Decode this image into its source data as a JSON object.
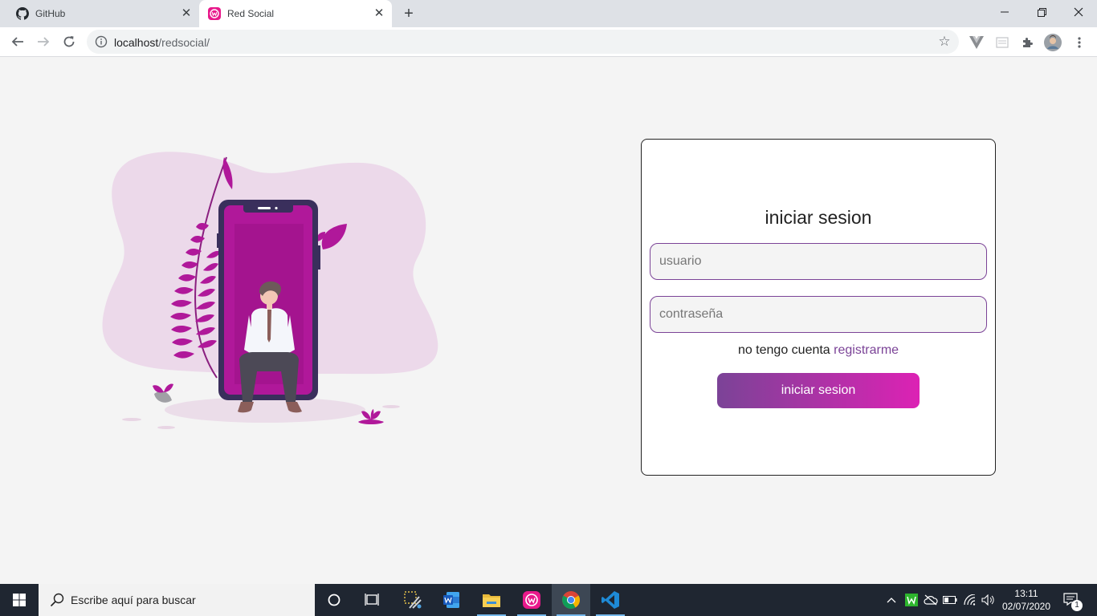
{
  "browser": {
    "tabs": [
      {
        "title": "GitHub",
        "icon": "github-icon"
      },
      {
        "title": "Red Social",
        "icon": "wamp-icon",
        "active": true
      }
    ],
    "url_host": "localhost",
    "url_path": "/redsocial/"
  },
  "login": {
    "title": "iniciar sesion",
    "user_placeholder": "usuario",
    "password_placeholder": "contraseña",
    "no_account_text": "no tengo cuenta",
    "register_link": "registrarme",
    "submit_label": "iniciar sesion"
  },
  "colors": {
    "accent": "#7b4397",
    "accent_end": "#dc22b4",
    "illustration_magenta": "#b0189a",
    "blob": "#ecd9ea"
  },
  "taskbar": {
    "search_placeholder": "Escribe aquí para buscar",
    "time": "13:11",
    "date": "02/07/2020",
    "notifications_count": "1"
  }
}
